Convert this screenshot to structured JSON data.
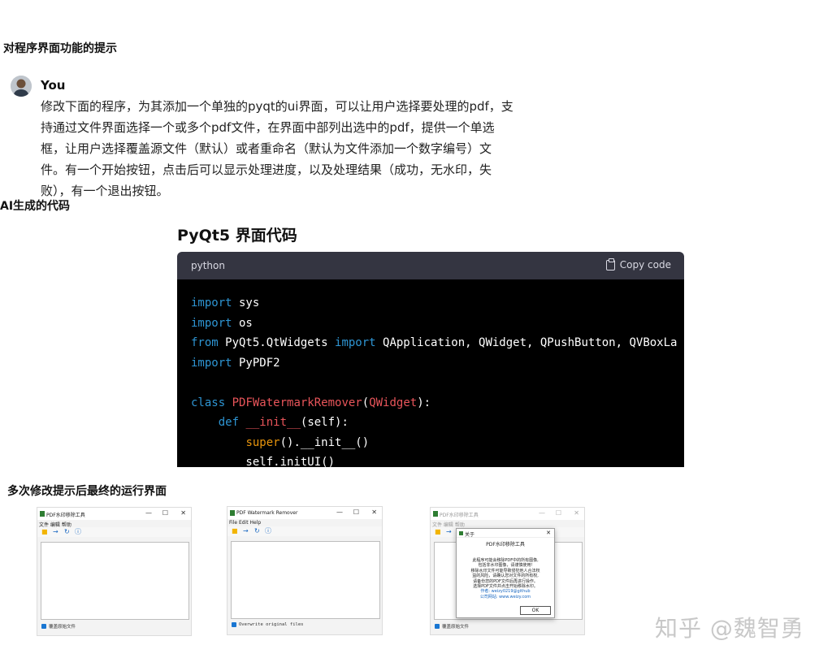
{
  "section1": {
    "heading": "对程序界面功能的提示"
  },
  "chat": {
    "user": "You",
    "lines": [
      "修改下面的程序，为其添加一个单独的pyqt的ui界面，可以让用户选择要处理的pdf，支",
      "持通过文件界面选择一个或多个pdf文件，在界面中部列出选中的pdf，提供一个单选",
      "框，让用户选择覆盖源文件（默认）或者重命名（默认为文件添加一个数字编号）文",
      "件。有一个开始按钮，点击后可以显示处理进度，以及处理结果（成功，无水印，失",
      "败），有一个退出按钮。"
    ]
  },
  "section2": {
    "heading": "AI生成的代码"
  },
  "code_section": {
    "title": "PyQt5 界面代码",
    "language": "python",
    "copy_label": "Copy code",
    "lines": [
      "import sys",
      "import os",
      "from PyQt5.QtWidgets import QApplication, QWidget, QPushButton, QVBoxLa",
      "import PyPDF2",
      "",
      "class PDFWatermarkRemover(QWidget):",
      "    def __init__(self):",
      "        super().__init__()",
      "        self.initUI()"
    ]
  },
  "section3": {
    "heading": "多次修改提示后最终的运行界面"
  },
  "screenshots": [
    {
      "title": "PDF水印移除工具",
      "menu": "文件  编辑  帮助",
      "checkbox": "覆盖原始文件"
    },
    {
      "title": "PDF Watermark Remover",
      "menu": "File  Edit  Help",
      "checkbox": "Overwrite original files"
    },
    {
      "title": "PDF水印移除工具",
      "menu": "文件  编辑  帮助",
      "checkbox": "覆盖原始文件",
      "dialog": {
        "title": "关于",
        "heading": "PDF水印移除工具",
        "lines": [
          "此程序可能会移除PDF中的所有图像,",
          "包括非水印图像，请谨慎使用!",
          "移除水印文件可能导致侵犯他人合法权",
          "益的风险，请确认您对文件的所有权,",
          "请备份您的PDF文件后再进行操作。",
          "选择PDF文件并点击开始移除水印。",
          "作者: weizy0219@github",
          "公司网站: www.weizy.com"
        ],
        "ok": "OK"
      }
    }
  ],
  "watermark": "知乎 @魏智勇"
}
